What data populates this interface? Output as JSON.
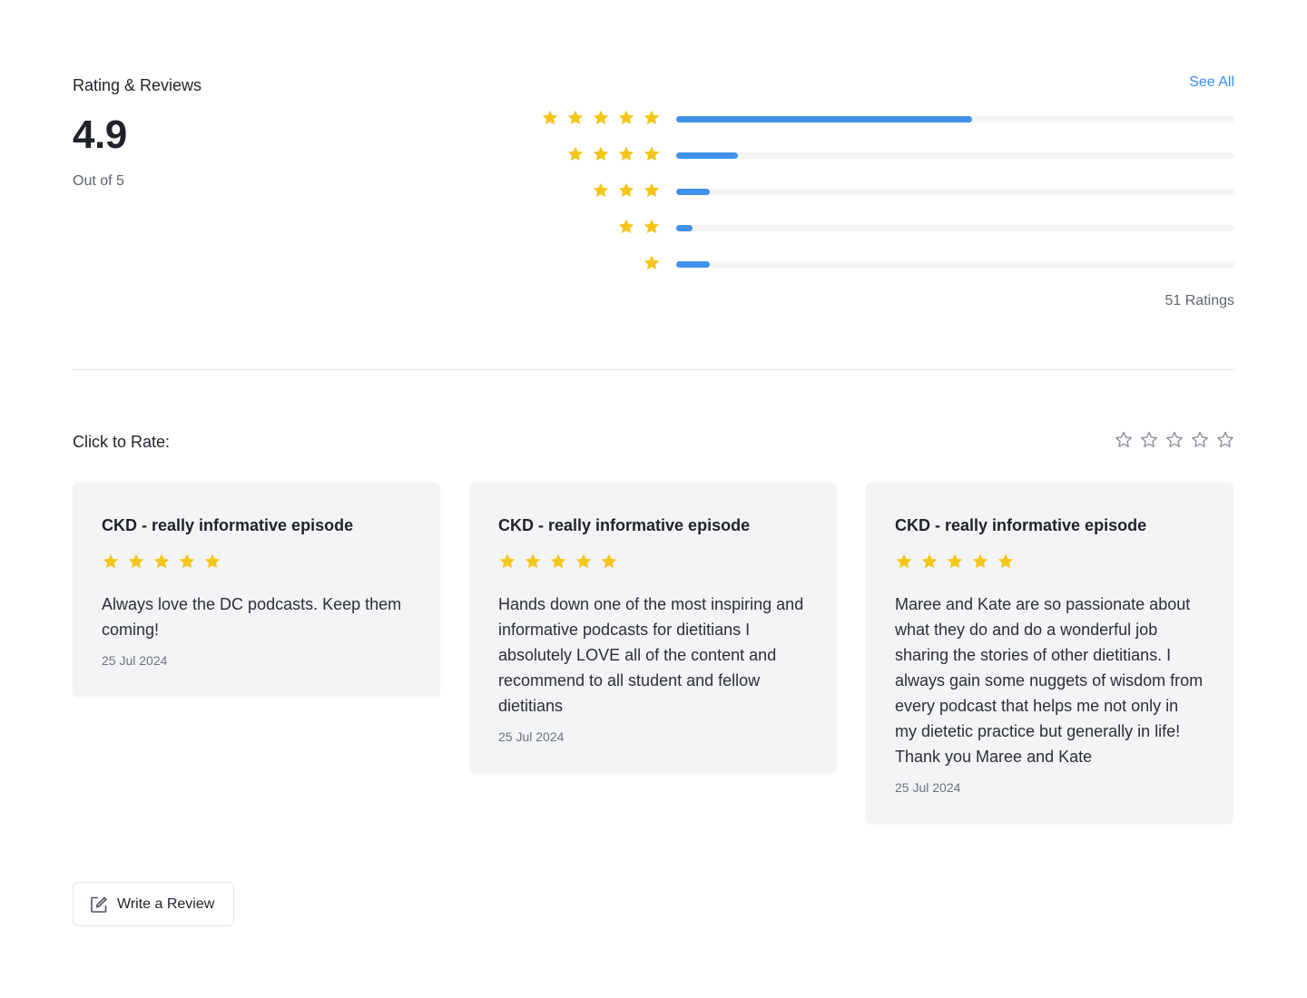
{
  "header": {
    "title": "Rating & Reviews",
    "see_all": "See All"
  },
  "summary": {
    "score": "4.9",
    "out_of": "Out of 5",
    "ratings_count": "51 Ratings"
  },
  "distribution": [
    {
      "stars": 5,
      "fraction": 0.53
    },
    {
      "stars": 4,
      "fraction": 0.11
    },
    {
      "stars": 3,
      "fraction": 0.06
    },
    {
      "stars": 2,
      "fraction": 0.03
    },
    {
      "stars": 1,
      "fraction": 0.06
    }
  ],
  "rate": {
    "label": "Click to Rate:",
    "star_count": 5
  },
  "reviews": [
    {
      "title": "CKD - really informative episode",
      "rating": 5,
      "text": "Always love the DC podcasts. Keep them coming!",
      "date": "25 Jul 2024"
    },
    {
      "title": "CKD - really informative episode",
      "rating": 5,
      "text": "Hands down one of the most inspiring and informative podcasts for dietitians I absolutely LOVE all of the content and recommend to all student and fellow dietitians",
      "date": "25 Jul 2024"
    },
    {
      "title": "CKD - really informative episode",
      "rating": 5,
      "text": "Maree and Kate are so passionate about what they do and do a wonderful job sharing the stories of other dietitians. I always gain some nuggets of wisdom from every podcast that helps me not only in my dietetic practice but generally in life! Thank you Maree and Kate",
      "date": "25 Jul 2024"
    }
  ],
  "write_review": {
    "label": "Write a Review",
    "icon": "edit-icon"
  },
  "colors": {
    "star": "#f5c518",
    "bar": "#4092ea",
    "link": "#3b8ced",
    "card_bg": "#f3f4f6"
  }
}
